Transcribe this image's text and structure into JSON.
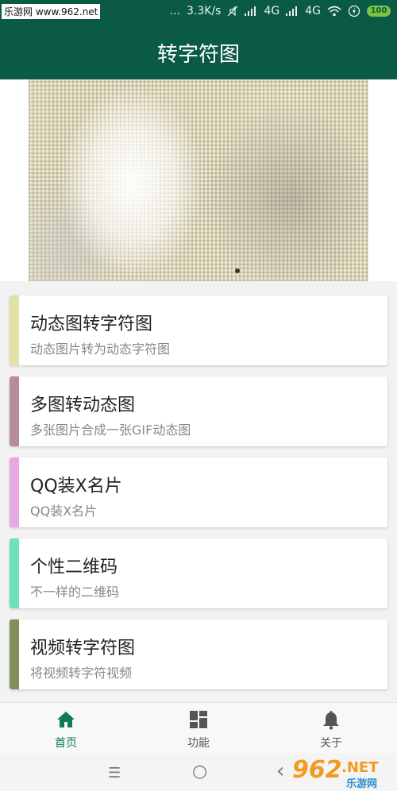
{
  "statusbar": {
    "watermark": "乐游网 www.962.net",
    "dots": "...",
    "speed": "3.3K/s",
    "net1": "4G",
    "net2": "4G",
    "battery": "100"
  },
  "appbar": {
    "title": "转字符图"
  },
  "menu": [
    {
      "title": "动态图转字符图",
      "subtitle": "动态图片转为动态字符图",
      "color": "#e2e2a8"
    },
    {
      "title": "多图转动态图",
      "subtitle": "多张图片合成一张GIF动态图",
      "color": "#b78c97"
    },
    {
      "title": "QQ装X名片",
      "subtitle": "QQ装X名片",
      "color": "#e8a8e0"
    },
    {
      "title": "个性二维码",
      "subtitle": "不一样的二维码",
      "color": "#6fe0b8"
    },
    {
      "title": "视频转字符图",
      "subtitle": "将视频转字符视频",
      "color": "#7f8f55"
    }
  ],
  "bottomnav": {
    "items": [
      {
        "label": "首页",
        "icon": "home-icon",
        "active": true
      },
      {
        "label": "功能",
        "icon": "grid-icon",
        "active": false
      },
      {
        "label": "关于",
        "icon": "bell-icon",
        "active": false
      }
    ],
    "active_color": "#0b7a5e",
    "inactive_color": "#555555"
  },
  "sysnav": {
    "menu_glyph": "☰",
    "home_glyph": "○",
    "back_glyph": "‹"
  },
  "logo": {
    "text": "962",
    "suffix": ".NET",
    "sub": "乐游网"
  }
}
